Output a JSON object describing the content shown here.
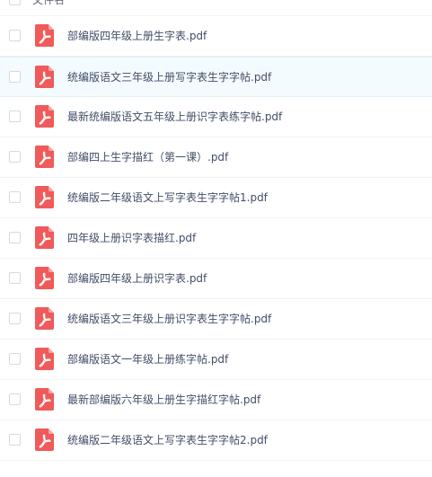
{
  "header": {
    "column_label": "文件名"
  },
  "file_icon": "pdf-icon",
  "accent_color": "#f05a5a",
  "files": [
    {
      "name": "部编版四年级上册生字表.pdf"
    },
    {
      "name": "统编版语文三年级上册写字表生字字帖.pdf"
    },
    {
      "name": "最新统编版语文五年级上册识字表练字帖.pdf"
    },
    {
      "name": "部编四上生字描红（第一课）.pdf"
    },
    {
      "name": "统编版二年级语文上写字表生字字帖1.pdf"
    },
    {
      "name": "四年级上册识字表描红.pdf"
    },
    {
      "name": "部编版四年级上册识字表.pdf"
    },
    {
      "name": "统编版语文三年级上册识字表生字字帖.pdf"
    },
    {
      "name": "部编版语文一年级上册练字帖.pdf"
    },
    {
      "name": "最新部编版六年级上册生字描红字帖.pdf"
    },
    {
      "name": "统编版二年级语文上写字表生字字帖2.pdf"
    }
  ]
}
